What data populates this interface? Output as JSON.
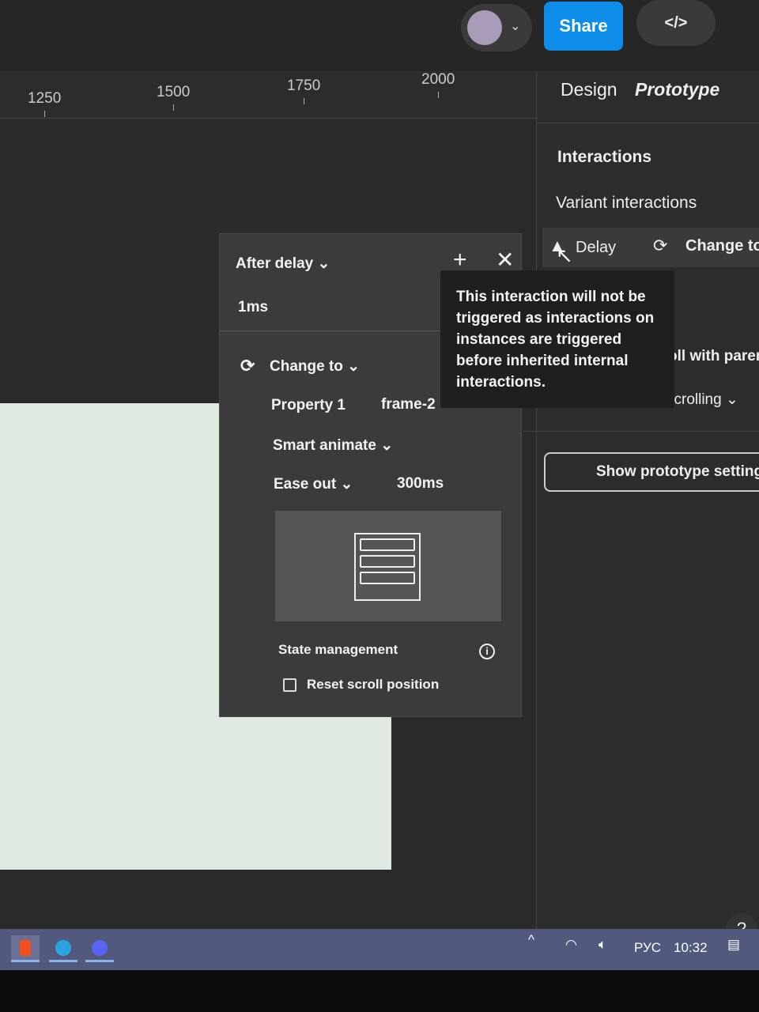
{
  "topbar": {
    "share_label": "Share",
    "code_label": "</>",
    "avatar_chevron": "⌄"
  },
  "ruler": {
    "ticks": [
      "1250",
      "1500",
      "1750",
      "2000"
    ]
  },
  "panel": {
    "tabs": [
      "Design",
      "Prototype"
    ],
    "interactions_label": "Interactions",
    "variant_interactions_label": "Variant interactions",
    "row_trigger": "Delay",
    "row_action": "Change to",
    "scroll_with_parent": "oll with paren",
    "scrolling": "scrolling",
    "show_prototype_settings": "Show prototype settings",
    "help": "?"
  },
  "popup": {
    "trigger": "After delay",
    "delay_value": "1ms",
    "action": "Change to",
    "property_name": "Property 1",
    "property_value": "frame-2",
    "animation": "Smart animate",
    "easing": "Ease out",
    "duration": "300ms",
    "state_management": "State management",
    "reset_scroll": "Reset scroll position",
    "reset_scroll_checked": false
  },
  "tooltip": {
    "text": "This interaction will not be triggered as interactions on instances are triggered before inherited internal interactions."
  },
  "taskbar": {
    "apps": [
      "figma-icon",
      "telegram-icon",
      "discord-icon"
    ],
    "language": "РУС",
    "time": "10:32"
  },
  "colors": {
    "accent": "#0d8ce9",
    "panel": "#2c2c2c",
    "popup": "#3b3b3b",
    "tooltip": "#1f1f1f",
    "taskbar": "#515a7e"
  }
}
